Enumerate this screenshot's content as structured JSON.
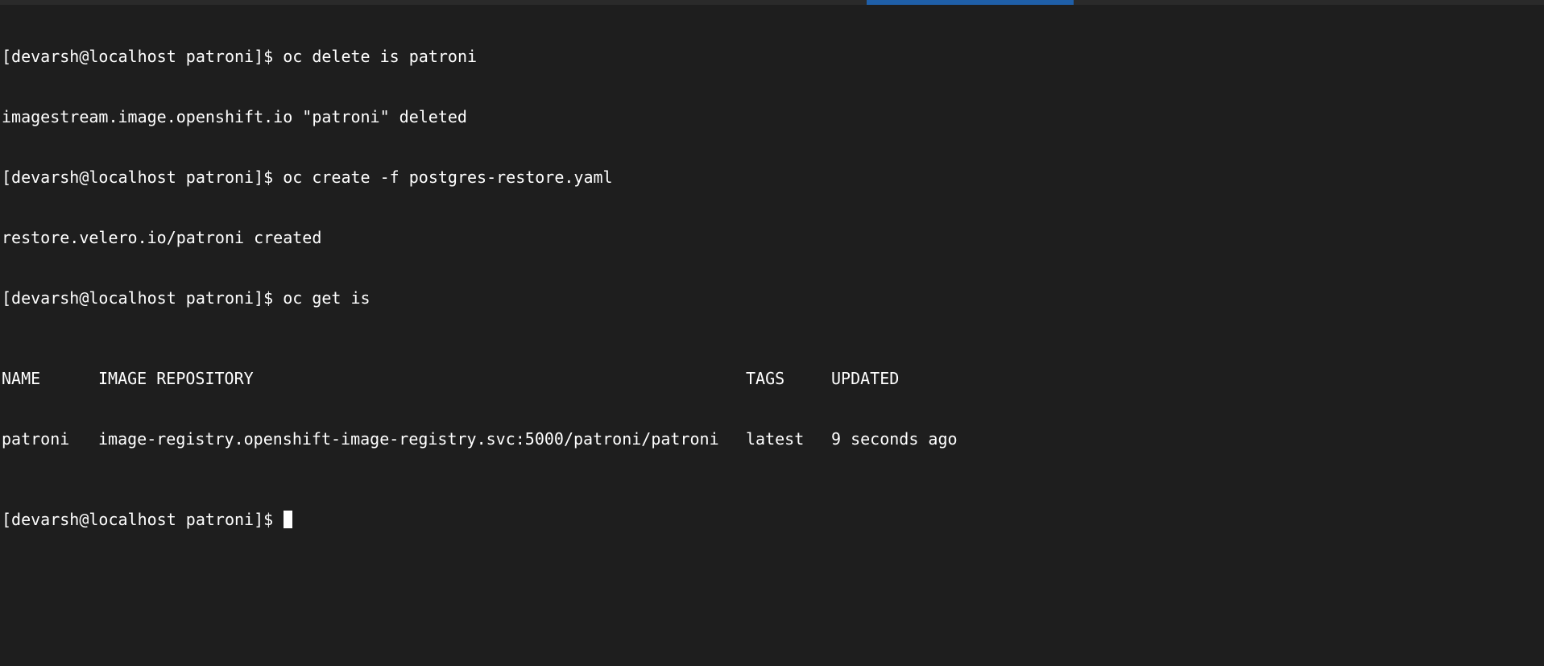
{
  "terminal": {
    "prompt": "[devarsh@localhost patroni]$",
    "lines": [
      {
        "type": "command",
        "prompt": "[devarsh@localhost patroni]$",
        "command": "oc delete is patroni"
      },
      {
        "type": "output",
        "text": "imagestream.image.openshift.io \"patroni\" deleted"
      },
      {
        "type": "command",
        "prompt": "[devarsh@localhost patroni]$",
        "command": "oc create -f postgres-restore.yaml"
      },
      {
        "type": "output",
        "text": "restore.velero.io/patroni created"
      },
      {
        "type": "command",
        "prompt": "[devarsh@localhost patroni]$",
        "command": "oc get is"
      }
    ],
    "table": {
      "headers": [
        "NAME",
        "IMAGE REPOSITORY",
        "TAGS",
        "UPDATED"
      ],
      "rows": [
        [
          "patroni",
          "image-registry.openshift-image-registry.svc:5000/patroni/patroni",
          "latest",
          "9 seconds ago"
        ]
      ]
    },
    "current_prompt": "[devarsh@localhost patroni]$",
    "current_input": ""
  },
  "colors": {
    "background": "#1e1e1e",
    "foreground": "#ffffff",
    "accent": "#1f5fa8"
  }
}
